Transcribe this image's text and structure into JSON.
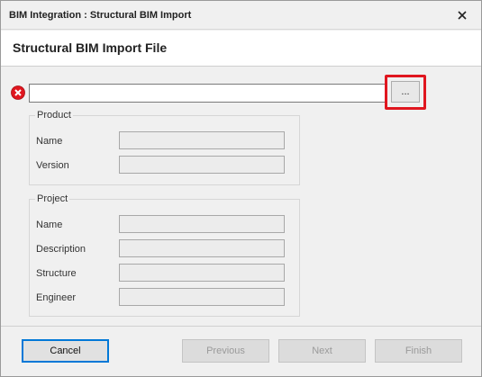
{
  "window": {
    "title": "BIM Integration : Structural BIM Import"
  },
  "header": {
    "title": "Structural BIM Import File"
  },
  "file_input": {
    "value": "",
    "browse_label": "...",
    "status_icon": "error-icon"
  },
  "product": {
    "group_title": "Product",
    "fields": [
      {
        "label": "Name",
        "value": ""
      },
      {
        "label": "Version",
        "value": ""
      }
    ]
  },
  "project": {
    "group_title": "Project",
    "fields": [
      {
        "label": "Name",
        "value": ""
      },
      {
        "label": "Description",
        "value": ""
      },
      {
        "label": "Structure",
        "value": ""
      },
      {
        "label": "Engineer",
        "value": ""
      }
    ]
  },
  "footer": {
    "cancel_label": "Cancel",
    "previous_label": "Previous",
    "next_label": "Next",
    "finish_label": "Finish"
  },
  "colors": {
    "highlight": "#e0161f",
    "focus_border": "#0078d7",
    "error": "#e0161f"
  }
}
